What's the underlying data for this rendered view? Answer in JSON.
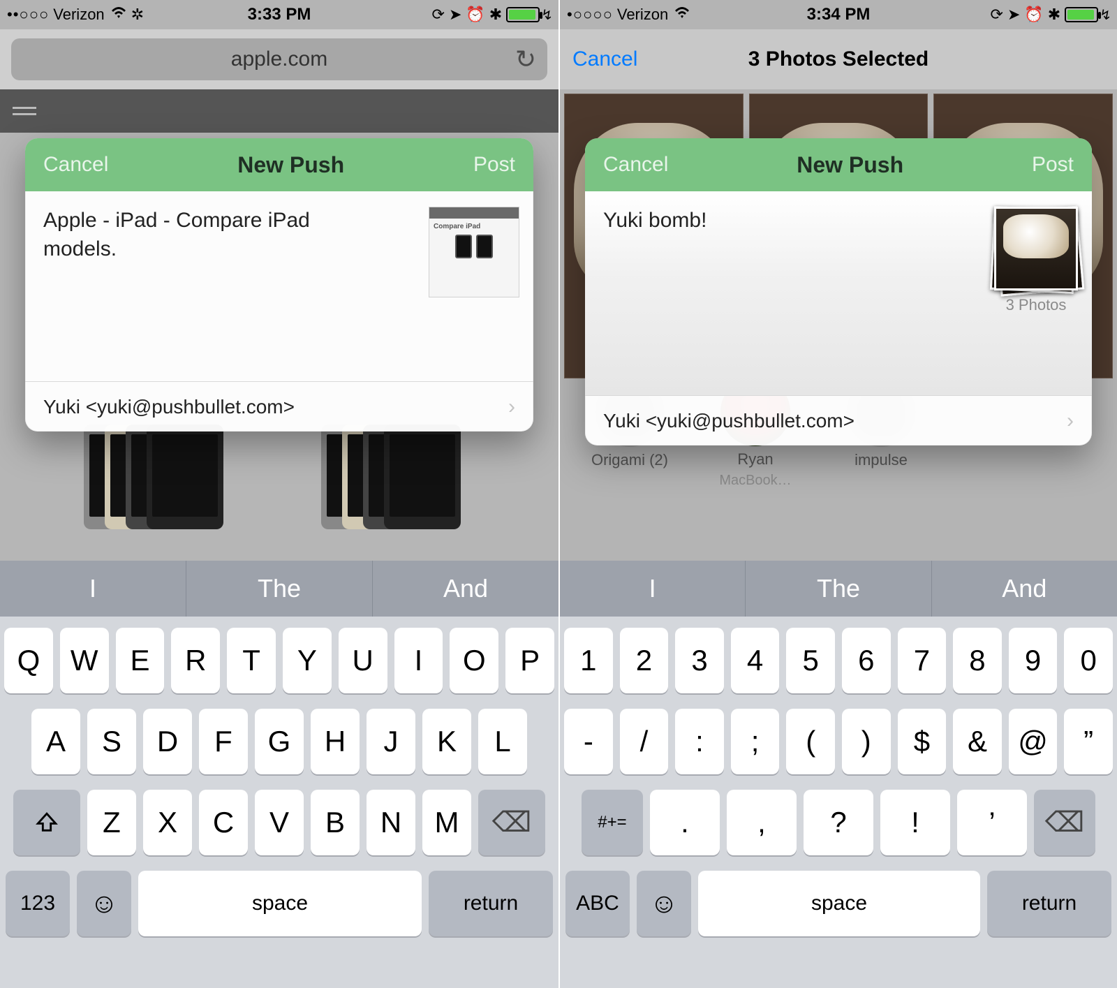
{
  "left": {
    "status": {
      "dots": "••○○○",
      "carrier": "Verizon",
      "time": "3:33 PM",
      "icons": [
        "orientation-lock",
        "location",
        "alarm",
        "bluetooth"
      ],
      "battery_pct": 85
    },
    "safari": {
      "url": "apple.com"
    },
    "modal": {
      "cancel": "Cancel",
      "title": "New Push",
      "post": "Post",
      "message": "Apple - iPad - Compare iPad models.",
      "preview_title": "Compare iPad",
      "recipient": "Yuki <yuki@pushbullet.com>"
    },
    "predictive": [
      "I",
      "The",
      "And"
    ],
    "kbd": {
      "rows": [
        [
          "Q",
          "W",
          "E",
          "R",
          "T",
          "Y",
          "U",
          "I",
          "O",
          "P"
        ],
        [
          "A",
          "S",
          "D",
          "F",
          "G",
          "H",
          "J",
          "K",
          "L"
        ],
        [
          "Z",
          "X",
          "C",
          "V",
          "B",
          "N",
          "M"
        ]
      ],
      "mode": "123",
      "space": "space",
      "return": "return"
    }
  },
  "right": {
    "status": {
      "dots": "•○○○○",
      "carrier": "Verizon",
      "time": "3:34 PM",
      "icons": [
        "orientation-lock",
        "location",
        "alarm",
        "bluetooth"
      ],
      "battery_pct": 85
    },
    "photosNav": {
      "cancel": "Cancel",
      "title": "3 Photos Selected"
    },
    "modal": {
      "cancel": "Cancel",
      "title": "New Push",
      "post": "Post",
      "message": "Yuki bomb!",
      "photo_count_label": "3 Photos",
      "recipient": "Yuki <yuki@pushbullet.com>"
    },
    "shareTargets": [
      {
        "name": "Origami (2)",
        "sub": ""
      },
      {
        "name": "Ryan",
        "sub": "MacBook…"
      },
      {
        "name": "impulse",
        "sub": ""
      }
    ],
    "predictive": [
      "I",
      "The",
      "And"
    ],
    "kbd": {
      "rows": [
        [
          "1",
          "2",
          "3",
          "4",
          "5",
          "6",
          "7",
          "8",
          "9",
          "0"
        ],
        [
          "-",
          "/",
          ":",
          ";",
          "(",
          ")",
          "$",
          "&",
          "@",
          "”"
        ],
        [
          ".",
          ",",
          "?",
          "!",
          "’"
        ]
      ],
      "mode": "ABC",
      "sym": "#+=",
      "space": "space",
      "return": "return"
    }
  }
}
